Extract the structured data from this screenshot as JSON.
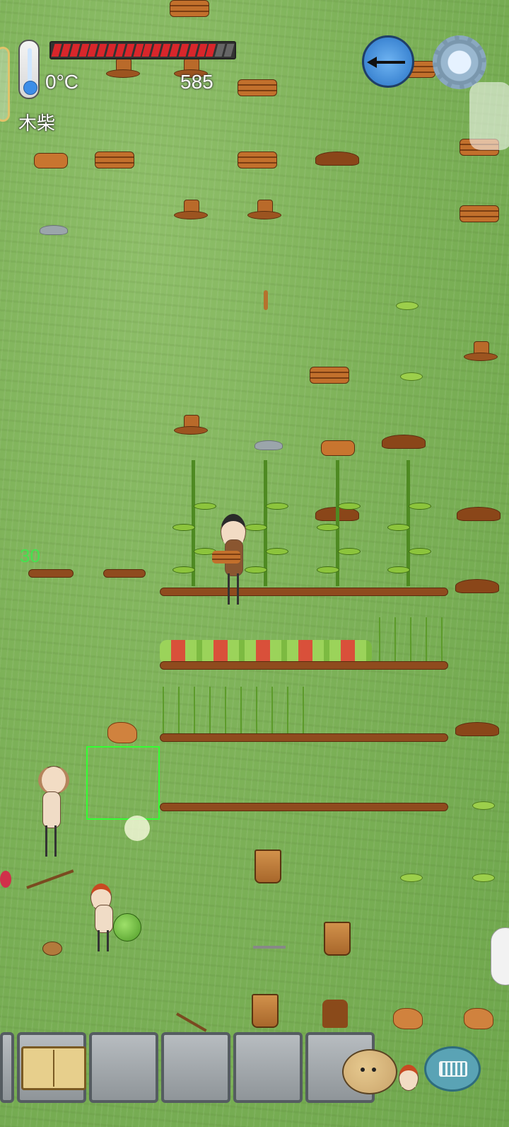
{
  "hud": {
    "temperature": "0°C",
    "health_fraction": 0.9,
    "counter": "585",
    "held_item": "木柴",
    "hunger_indicator": "30"
  },
  "icons": {
    "thermometer": "thermometer-icon",
    "compass": "compass-icon",
    "settings": "gear-icon",
    "recipe_book": "book-icon",
    "emote": "potato-face-icon",
    "chat": "keyboard-icon"
  },
  "colors": {
    "grass": "#7db057",
    "health": "#d8262b",
    "selection": "#33ff33",
    "hunger_text": "#44e44f"
  }
}
